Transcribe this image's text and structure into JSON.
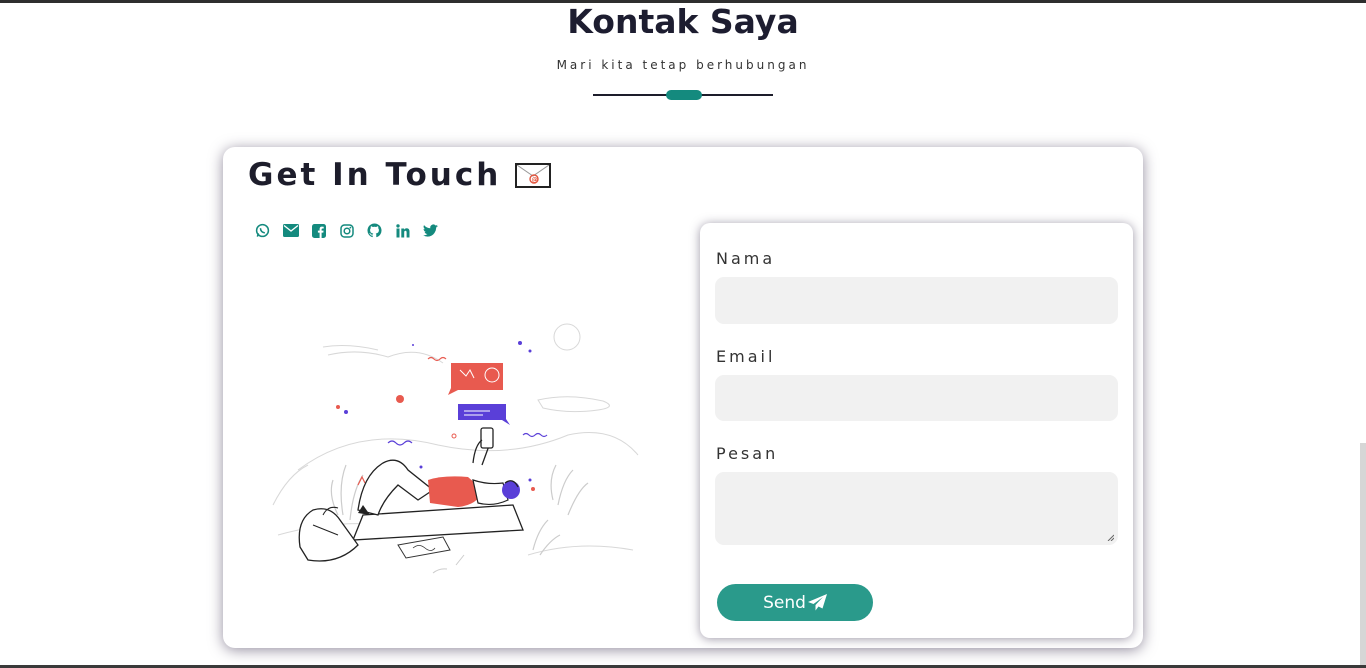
{
  "header": {
    "title": "Kontak Saya",
    "subtitle": "Mari kita tetap berhubungan"
  },
  "card": {
    "title": "Get In Touch"
  },
  "socials": [
    {
      "name": "whatsapp-icon"
    },
    {
      "name": "email-icon"
    },
    {
      "name": "facebook-icon"
    },
    {
      "name": "instagram-icon"
    },
    {
      "name": "github-icon"
    },
    {
      "name": "linkedin-icon"
    },
    {
      "name": "twitter-icon"
    }
  ],
  "form": {
    "name_label": "Nama",
    "name_value": "",
    "email_label": "Email",
    "email_value": "",
    "message_label": "Pesan",
    "message_value": "",
    "send_label": "Send"
  },
  "colors": {
    "accent": "#148a7e",
    "button": "#2a9a8b",
    "input_bg": "#f1f1f1"
  }
}
